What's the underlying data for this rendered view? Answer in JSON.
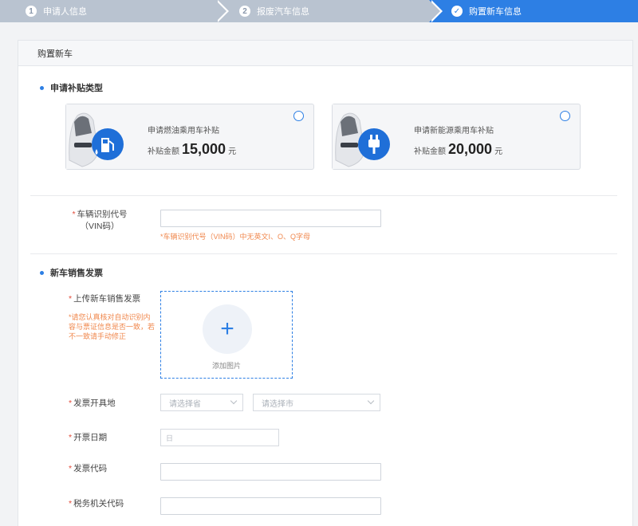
{
  "steps": [
    {
      "num": "1",
      "label": "申请人信息"
    },
    {
      "num": "2",
      "label": "报废汽车信息"
    },
    {
      "num": "✓",
      "label": "购置新车信息"
    }
  ],
  "panel": {
    "title": "购置新车"
  },
  "subsidy": {
    "section_title": "申请补贴类型",
    "cards": [
      {
        "title": "申请燃油乘用车补贴",
        "amount_label": "补贴金额",
        "amount": "15,000",
        "unit": "元",
        "icon": "fuel-pump-icon"
      },
      {
        "title": "申请新能源乘用车补贴",
        "amount_label": "补贴金额",
        "amount": "20,000",
        "unit": "元",
        "icon": "ev-plug-icon"
      }
    ]
  },
  "vin": {
    "required": "*",
    "label_line1": "车辆识别代号",
    "label_line2": "（VIN码）",
    "value": "",
    "hint": "*车辆识别代号（VIN码）中无英文I、O、Q字母"
  },
  "invoice": {
    "section_title": "新车销售发票",
    "upload_label": "上传新车销售发票",
    "upload_hint": "*请您认真核对自动识别内容与票证信息是否一致，若不一致请手动修正",
    "add_image": "添加图片",
    "place_label": "发票开具地",
    "province_placeholder": "请选择省",
    "city_placeholder": "请选择市",
    "date_label": "开票日期",
    "date_placeholder": "日",
    "code_label": "发票代码",
    "tax_label": "税务机关代码"
  },
  "colors": {
    "accent": "#2d7fe4",
    "required": "#e24c3b",
    "hint": "#f0884e"
  }
}
